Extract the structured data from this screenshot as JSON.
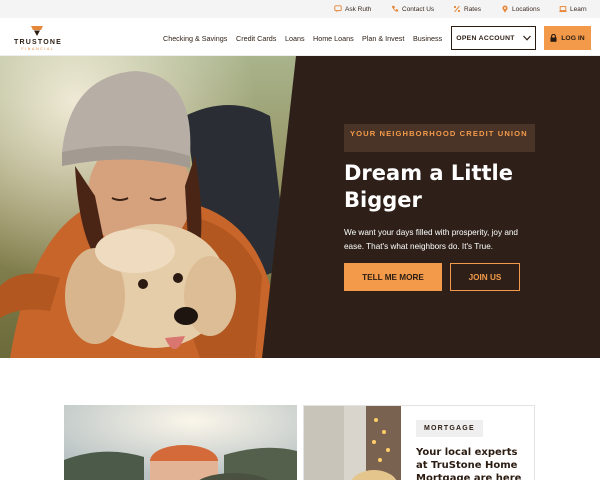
{
  "utility": {
    "items": [
      {
        "label": "Ask Ruth",
        "icon": "chat-icon"
      },
      {
        "label": "Contact Us",
        "icon": "phone-icon"
      },
      {
        "label": "Rates",
        "icon": "percent-icon"
      },
      {
        "label": "Locations",
        "icon": "map-pin-icon"
      },
      {
        "label": "Learn",
        "icon": "laptop-icon"
      }
    ]
  },
  "brand": {
    "name": "TRUSTONE",
    "tagline": "FINANCIAL",
    "accent": "#f39a4a",
    "dark": "#2e2019"
  },
  "nav": {
    "items": [
      "Checking & Savings",
      "Credit Cards",
      "Loans",
      "Home Loans",
      "Plan & Invest",
      "Business"
    ],
    "open_account": "OPEN ACCOUNT",
    "login": "LOG IN"
  },
  "hero": {
    "eyebrow": "YOUR NEIGHBORHOOD CREDIT UNION",
    "headline": "Dream a Little Bigger",
    "description": "We want your days filled with prosperity, joy and ease. That's what neighbors do. It's True.",
    "primary_cta": "TELL ME MORE",
    "secondary_cta": "JOIN US"
  },
  "cards": {
    "mortgage_badge": "MORTGAGE",
    "mortgage_title": "Your local experts at TruStone Home Mortgage are here"
  }
}
